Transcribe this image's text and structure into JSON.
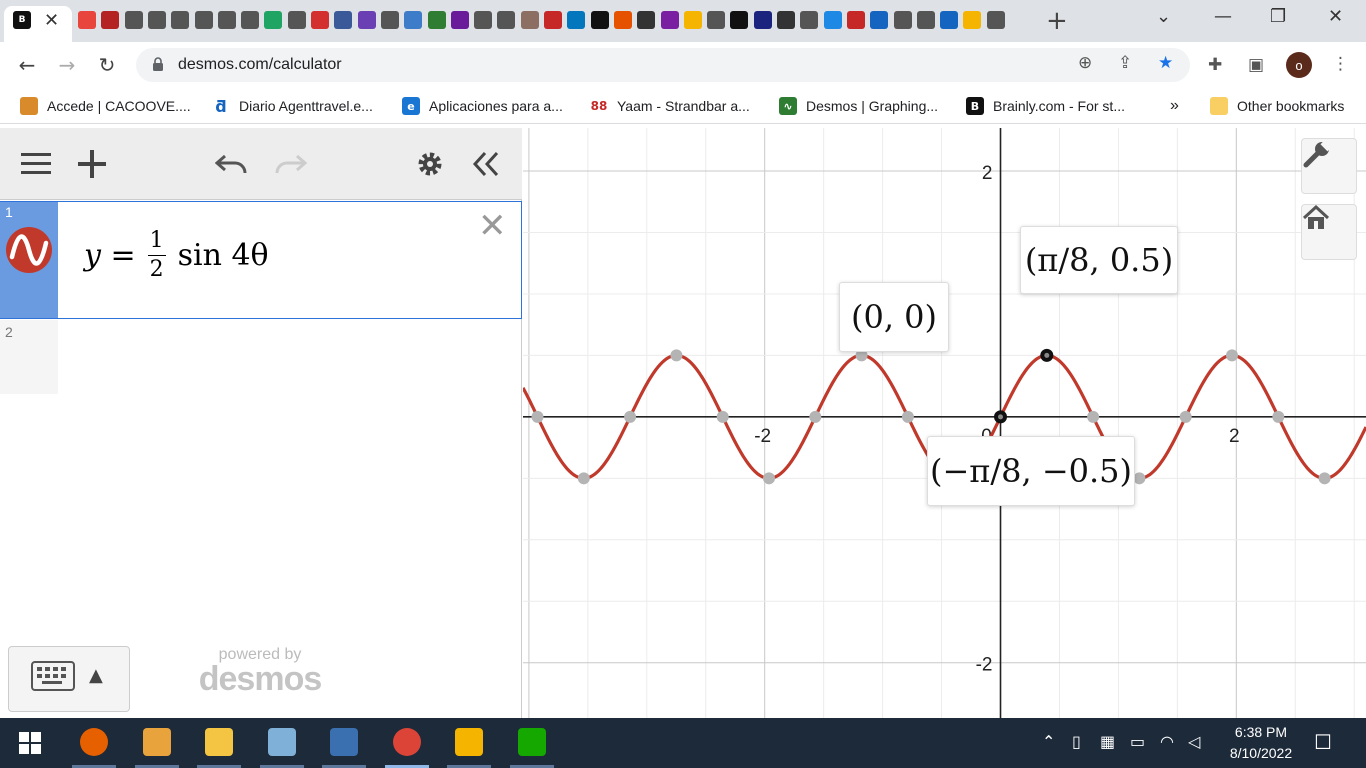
{
  "browser": {
    "tab_close": "✕",
    "new_tab": "+",
    "url": "desmos.com/calculator",
    "avatar_letter": "o",
    "tab_strip_colors": [
      "#e8453c",
      "#b52222",
      "#555",
      "#555",
      "#555",
      "#555",
      "#555",
      "#555",
      "#1fa463",
      "#555",
      "#d32f2f",
      "#3b5998",
      "#6a3fb3",
      "#555",
      "#3d7cc9",
      "#2e7d32",
      "#6a1b9a",
      "#555",
      "#555",
      "#8d6e63",
      "#c62828",
      "#0277bd",
      "#111",
      "#e65100",
      "#333",
      "#7b1fa2",
      "#f4b400",
      "#555",
      "#111",
      "#1a237e",
      "#333",
      "#555",
      "#1e88e5",
      "#c62828",
      "#1565c0",
      "#555",
      "#555",
      "#1565c0",
      "#f4b400",
      "#555"
    ]
  },
  "bookmarks": [
    {
      "label": "Accede | CACOOVE....",
      "icon": "cacoove-icon",
      "color": "#d98a2b"
    },
    {
      "label": "Diario Agenttravel.e...",
      "icon": "agenttravel-icon",
      "color": "#1565c0"
    },
    {
      "label": "Aplicaciones para a...",
      "icon": "ie-icon",
      "color": "#1976d2"
    },
    {
      "label": "Yaam - Strandbar a...",
      "icon": "yaam-icon",
      "color": "#c62828"
    },
    {
      "label": "Desmos | Graphing...",
      "icon": "desmos-icon",
      "color": "#2e7d32"
    },
    {
      "label": "Brainly.com - For st...",
      "icon": "brainly-icon",
      "color": "#111"
    }
  ],
  "bookmarks_more": "»",
  "other_bookmarks": "Other bookmarks",
  "expressions": [
    {
      "number": "1",
      "lhs": "y =",
      "frac_num": "1",
      "frac_den": "2",
      "rhs": "sin 4θ",
      "color": "#c0392b"
    },
    {
      "number": "2"
    }
  ],
  "expression_delete": "✕",
  "powered_by": "powered by",
  "desmos_brand": "desmos",
  "graph": {
    "x_range": [
      -4.05,
      3.1
    ],
    "y_range": [
      -2.45,
      2.35
    ],
    "grid": true,
    "x_tick_labels": [
      "-2",
      "0",
      "2"
    ],
    "y_tick_labels": [
      "2",
      "-2"
    ],
    "curve_color": "#c0392b",
    "point_labels": [
      {
        "text": "(π/8, 0.5)"
      },
      {
        "text": "(0, 0)"
      },
      {
        "text": "(−π/8, −0.5)"
      }
    ]
  },
  "chart_data": {
    "type": "line",
    "title": "",
    "series": [
      {
        "name": "y = 1/2 sin 4θ",
        "function": "0.5*sin(4*x)"
      }
    ],
    "highlighted_points": [
      {
        "x": 0.3927,
        "y": 0.5,
        "label": "(π/8, 0.5)"
      },
      {
        "x": 0,
        "y": 0,
        "label": "(0, 0)"
      },
      {
        "x": -0.3927,
        "y": -0.5,
        "label": "(−π/8, −0.5)"
      }
    ],
    "xlim": [
      -4.05,
      3.1
    ],
    "ylim": [
      -2.45,
      2.35
    ],
    "xticks": [
      -2,
      0,
      2
    ],
    "yticks": [
      2,
      -2
    ],
    "grid": true
  },
  "taskbar": {
    "time": "6:38 PM",
    "date": "8/10/2022",
    "apps": [
      {
        "icon": "firefox-icon",
        "color": "#e66000"
      },
      {
        "icon": "media-player-icon",
        "color": "#e9a33c"
      },
      {
        "icon": "file-explorer-icon",
        "color": "#f4c542"
      },
      {
        "icon": "paint-icon",
        "color": "#7fb0d8"
      },
      {
        "icon": "calculator-icon",
        "color": "#3a6fb0"
      },
      {
        "icon": "chrome-icon",
        "color": "#db4437"
      },
      {
        "icon": "library-icon",
        "color": "#f4b400"
      },
      {
        "icon": "upwork-icon",
        "color": "#14a800"
      }
    ]
  }
}
